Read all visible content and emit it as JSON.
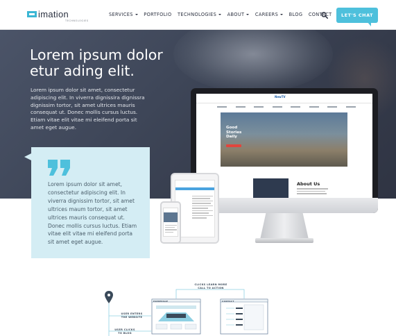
{
  "nav": {
    "logo_text": "imation",
    "logo_sub": "TECHNOLOGIES",
    "items": [
      {
        "label": "SERVICES",
        "dropdown": true
      },
      {
        "label": "PORTFOLIO",
        "dropdown": false
      },
      {
        "label": "TECHNOLOGIES",
        "dropdown": true
      },
      {
        "label": "ABOUT",
        "dropdown": true
      },
      {
        "label": "CAREERS",
        "dropdown": true
      },
      {
        "label": "BLOG",
        "dropdown": false
      },
      {
        "label": "CONTACT",
        "dropdown": false
      }
    ],
    "search_icon": "search-icon",
    "chat_label": "LET'S CHAT"
  },
  "hero": {
    "title_line1": "Lorem ipsum dolor",
    "title_line2": "etur ading elit.",
    "body": "Lorem ipsum dolor sit amet, consectetur adipiscing elit. In viverra dignissira dignissra dignissim tortor, sit amet ultrices mauris consequat ut. Donec mollis cursus luctus. Etiam vitae elit vitae mi eleifend porta sit amet eget augue."
  },
  "quote": {
    "icon": "quote-icon",
    "text": "Lorem ipsum dolor sit amet, consectetur adipiscing elit. In viverra dignissim tortor, sit amet ultrices maum tortor, sit amet ultrices mauris consequat ut. Donec mollis cursus luctus. Etiam vitae elit vitae mi eleifend porta sit amet eget augue."
  },
  "mockup": {
    "logo": "NewTV",
    "hero_title": "Good Stories Daily",
    "about_title": "About Us"
  },
  "flow": {
    "labels": {
      "clicks_learn_more": "CLICKS LEARN MORE CALL TO ACTION",
      "user_enters": "USER ENTERS THE WEBSITE",
      "user_clicks_blog": "USER CLICKS TO BLOG",
      "homepage": "HOMEPAGE",
      "contact": "CONTACT"
    }
  },
  "colors": {
    "accent": "#4ec0dc",
    "quote_bg": "#d4edf4",
    "hero_bg": "#3e4658",
    "nav_text": "#2c3140"
  }
}
